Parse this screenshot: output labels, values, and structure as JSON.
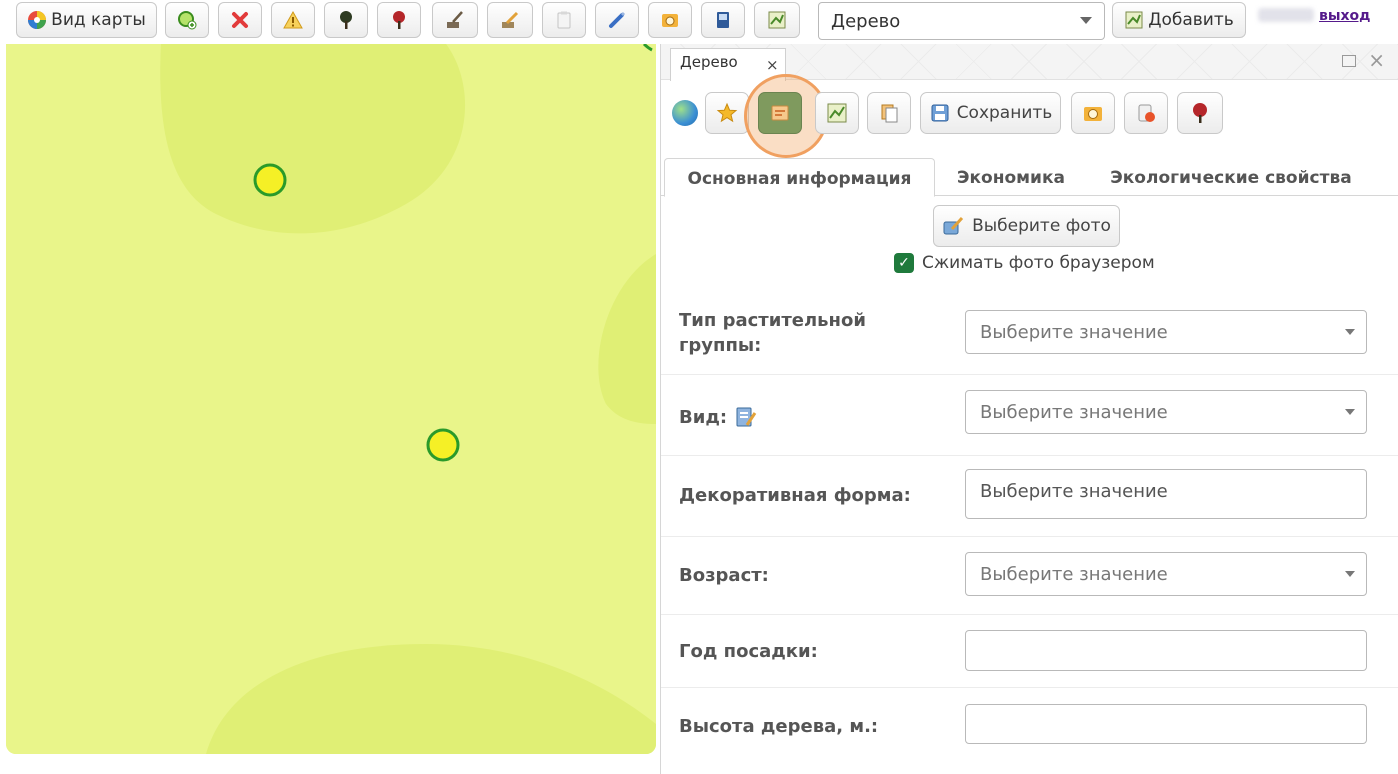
{
  "toolbar": {
    "view_map_label": "Вид карты",
    "layer_select_value": "Дерево",
    "add_label": "Добавить",
    "logout_label": "выход",
    "icons": [
      "add-circle-icon",
      "delete-icon",
      "warning-icon",
      "tree-dark-icon",
      "tree-red-icon",
      "brush-icon",
      "pencil-icon",
      "clipboard-icon",
      "pen-icon",
      "photo-icon",
      "book-icon",
      "map-icon"
    ]
  },
  "map": {
    "background": "#e9f58a",
    "marker_color": "#f5f026",
    "marker_border": "#2a9a2a"
  },
  "panel": {
    "tab_title": "Дерево",
    "tab_close": "×",
    "save_label": "Сохранить",
    "tabs": [
      "Основная информация",
      "Экономика",
      "Экологические свойства"
    ],
    "photo_button_label": "Выберите фото",
    "compress_label": "Сжимать фото браузером",
    "compress_checked": true,
    "accent": "#1f7a3c",
    "highlight": "#f0a060"
  },
  "form": {
    "veg_group_label": "Тип растительной группы:",
    "veg_group_value": "Выберите значение",
    "species_label": "Вид:",
    "species_value": "Выберите значение",
    "decor_label": "Декоративная форма:",
    "decor_value": "Выберите значение",
    "age_label": "Возраст:",
    "age_value": "Выберите значение",
    "year_label": "Год посадки:",
    "year_value": "",
    "height_label": "Высота дерева, м.:",
    "height_value": ""
  }
}
